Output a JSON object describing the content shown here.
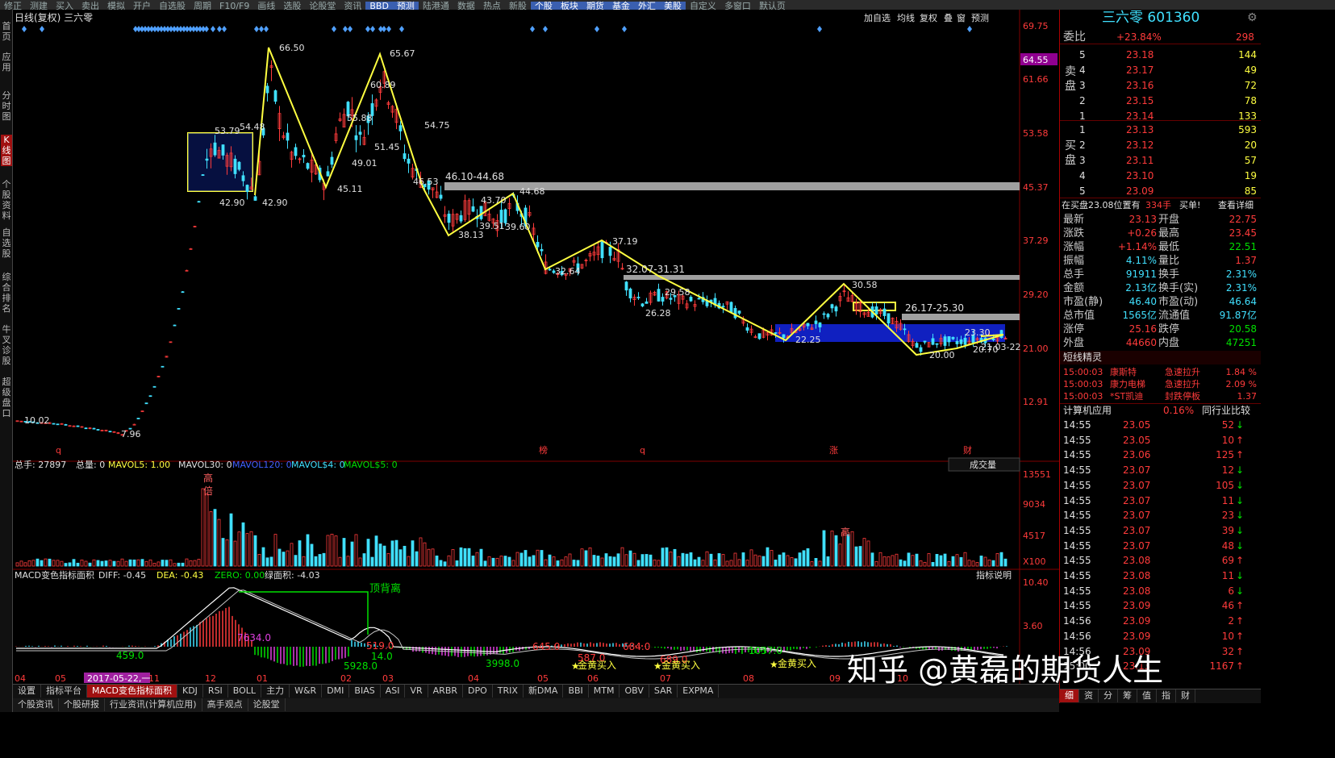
{
  "toolbar": {
    "items": [
      "修正",
      "测建",
      "买入",
      "卖出",
      "模拟",
      "开户",
      "自选股",
      "周期",
      "F10/F9",
      "画线",
      "选股",
      "论股堂",
      "资讯",
      "BBD",
      "预测",
      "陆港通",
      "数据",
      "热点",
      "新股",
      "个股",
      "板块",
      "期货",
      "基金",
      "外汇",
      "美股",
      "自定义",
      "多窗口",
      "默认页"
    ]
  },
  "leftnav": {
    "items": [
      "首页",
      "应用",
      "分时图",
      "K线图",
      "个股资料",
      "自选股",
      "综合排名",
      "牛叉诊股",
      "超级盘口"
    ]
  },
  "kchart": {
    "title": "日线(复权)  三六零",
    "right_menu": [
      "加自选",
      "均线",
      "复权",
      "叠",
      "窗",
      "预测"
    ],
    "price_axis": [
      "69.75",
      "61.66",
      "53.58",
      "45.37",
      "37.29",
      "29.20",
      "21.00",
      "12.91"
    ],
    "current_price_tag": "64.55",
    "bottom_markers": [
      "q",
      "榜",
      "q",
      "涨",
      "财"
    ],
    "annotations": {
      "p66_50": "66.50",
      "p65_67": "65.67",
      "p53_79": "53.79",
      "p54_48": "54.48",
      "p60_89": "60.89",
      "p54_75": "54.75",
      "p55_88": "55.88",
      "p51_45": "51.45",
      "p49_01": "49.01",
      "p45_11": "45.11",
      "p46_53": "46.53",
      "p42_90a": "42.90",
      "p42_90b": "42.90",
      "p43_70": "43.70",
      "p44_68": "44.68",
      "p39_51": "39.51",
      "p39_60": "39.60",
      "p38_13": "38.13",
      "p37_19": "37.19",
      "p32_64": "32.64",
      "p29_58": "29.58",
      "p26_28": "26.28",
      "p22_25": "22.25",
      "p30_58": "30.58",
      "p23_30": "23.30",
      "p20_00": "20.00",
      "p20_70": "20.70",
      "p21_03": "21.03",
      "p10_02": "10.02",
      "p7_96": "7.96",
      "zone1": "46.10-44.68",
      "zone2": "32.07-31.31",
      "zone3": "26.17-25.30",
      "zone4": "21.03-22"
    }
  },
  "volume": {
    "label": "总手: 27897",
    "total": "总量: 0",
    "mavol5": "MAVOL5: 1.00",
    "mavol30": "MAVOL30: 0",
    "mavol120": "MAVOL120: 0",
    "mavols4": "MAVOL$4: 0",
    "mavols5": "MAVOL$5: 0",
    "selector": "成交量",
    "axis": [
      "13551",
      "9034",
      "4517",
      "X100"
    ],
    "markers": [
      "高",
      "倍",
      "高"
    ]
  },
  "macd": {
    "title": "MACD变色指标面积",
    "diff": "DIFF: -0.45",
    "dea": "DEA: -0.43",
    "zero": "ZERO: 0.00",
    "green_area": "绿面积: -4.03",
    "help": "指标说明",
    "axis": [
      "10.40",
      "3.60"
    ],
    "labels": {
      "div": "顶背离",
      "v459": "459.0",
      "v7634": "7634.0",
      "v519": "519.0",
      "v14": "14.0",
      "v5928": "5928.0",
      "v3998": "3998.0",
      "v645": "645.0",
      "v684": "684.0",
      "v1037": "1037.0",
      "v587": "587.0",
      "v689": "689.0",
      "buy1": "金黄买入",
      "buy2": "金黄买入",
      "buy3": "金黄买入"
    },
    "months": [
      "04",
      "05",
      "2017-05-22,一",
      "11",
      "12",
      "01",
      "02",
      "03",
      "04",
      "05",
      "06",
      "07",
      "08",
      "09",
      "10"
    ]
  },
  "tabs": [
    "设置",
    "指标平台",
    "MACD变色指标面积",
    "KDJ",
    "RSI",
    "BOLL",
    "主力",
    "W&R",
    "DMI",
    "BIAS",
    "ASI",
    "VR",
    "ARBR",
    "DPO",
    "TRIX",
    "新DMA",
    "BBI",
    "MTM",
    "OBV",
    "SAR",
    "EXPMA"
  ],
  "tabs2": [
    "个股资讯",
    "个股研报",
    "行业资讯(计算机应用)",
    "高手观点",
    "论股堂"
  ],
  "quote": {
    "name": "三六零 601360",
    "weibi_label": "委比",
    "weibi": "+23.84%",
    "weicha": "298",
    "sell_label": "卖盘",
    "buy_label": "买盘",
    "asks": [
      {
        "lvl": "5",
        "price": "23.18",
        "vol": "144"
      },
      {
        "lvl": "4",
        "price": "23.17",
        "vol": "49"
      },
      {
        "lvl": "3",
        "price": "23.16",
        "vol": "72"
      },
      {
        "lvl": "2",
        "price": "23.15",
        "vol": "78"
      },
      {
        "lvl": "1",
        "price": "23.14",
        "vol": "133"
      }
    ],
    "bids": [
      {
        "lvl": "1",
        "price": "23.13",
        "vol": "593"
      },
      {
        "lvl": "2",
        "price": "23.12",
        "vol": "20"
      },
      {
        "lvl": "3",
        "price": "23.11",
        "vol": "57"
      },
      {
        "lvl": "4",
        "price": "23.10",
        "vol": "19"
      },
      {
        "lvl": "5",
        "price": "23.09",
        "vol": "85"
      }
    ],
    "position_note": "在买盘23.08位置有",
    "position_vol": "334手",
    "position_tag": "买单!",
    "detail_link": "查看详细",
    "stats": [
      {
        "l1": "最新",
        "v1": "23.13",
        "l2": "开盘",
        "v2": "22.75"
      },
      {
        "l1": "涨跌",
        "v1": "+0.26",
        "l2": "最高",
        "v2": "23.45"
      },
      {
        "l1": "涨幅",
        "v1": "+1.14%",
        "l2": "最低",
        "v2": "22.51"
      },
      {
        "l1": "振幅",
        "v1": "4.11%",
        "l2": "量比",
        "v2": "1.37"
      },
      {
        "l1": "总手",
        "v1": "91911",
        "l2": "换手",
        "v2": "2.31%"
      },
      {
        "l1": "金额",
        "v1": "2.13亿",
        "l2": "换手(实)",
        "v2": "2.31%"
      },
      {
        "l1": "市盈(静)",
        "v1": "46.40",
        "l2": "市盈(动)",
        "v2": "46.64"
      },
      {
        "l1": "总市值",
        "v1": "1565亿",
        "l2": "流通值",
        "v2": "91.87亿"
      },
      {
        "l1": "涨停",
        "v1": "25.16",
        "l2": "跌停",
        "v2": "20.58"
      },
      {
        "l1": "外盘",
        "v1": "44660",
        "l2": "内盘",
        "v2": "47251"
      }
    ],
    "spirit_title": "短线精灵",
    "spirit": [
      {
        "time": "15:00:03",
        "name": "康斯特",
        "act": "急速拉升",
        "pct": "1.84 %"
      },
      {
        "time": "15:00:03",
        "name": "康力电梯",
        "act": "急速拉升",
        "pct": "2.09 %"
      },
      {
        "time": "15:00:03",
        "name": "*ST凯迪",
        "act": "封跌停板",
        "pct": "1.37"
      }
    ],
    "industry": "计算机应用",
    "industry_pct": "0.16%",
    "industry_cmp": "同行业比较",
    "ticks": [
      {
        "t": "14:55",
        "p": "23.05",
        "v": "52",
        "d": "down"
      },
      {
        "t": "14:55",
        "p": "23.05",
        "v": "10",
        "d": "up"
      },
      {
        "t": "14:55",
        "p": "23.06",
        "v": "125",
        "d": "up"
      },
      {
        "t": "14:55",
        "p": "23.07",
        "v": "12",
        "d": "down"
      },
      {
        "t": "14:55",
        "p": "23.07",
        "v": "105",
        "d": "down"
      },
      {
        "t": "14:55",
        "p": "23.07",
        "v": "11",
        "d": "down"
      },
      {
        "t": "14:55",
        "p": "23.07",
        "v": "23",
        "d": "down"
      },
      {
        "t": "14:55",
        "p": "23.07",
        "v": "39",
        "d": "down"
      },
      {
        "t": "14:55",
        "p": "23.07",
        "v": "48",
        "d": "down"
      },
      {
        "t": "14:55",
        "p": "23.08",
        "v": "69",
        "d": "up"
      },
      {
        "t": "14:55",
        "p": "23.08",
        "v": "11",
        "d": "down"
      },
      {
        "t": "14:55",
        "p": "23.08",
        "v": "6",
        "d": "down"
      },
      {
        "t": "14:55",
        "p": "23.09",
        "v": "46",
        "d": "up"
      },
      {
        "t": "14:56",
        "p": "23.09",
        "v": "2",
        "d": "up"
      },
      {
        "t": "14:56",
        "p": "23.09",
        "v": "10",
        "d": "up"
      },
      {
        "t": "14:56",
        "p": "23.09",
        "v": "32",
        "d": "up"
      },
      {
        "t": "15:00",
        "p": "23.13",
        "v": "1167",
        "d": "up"
      }
    ],
    "bottom_tabs": [
      "细",
      "资",
      "分",
      "筹",
      "值",
      "指",
      "财"
    ]
  },
  "watermark": "知乎 @黄磊的期货人生",
  "colors": {
    "up": "#ff3b3b",
    "down": "#40e0ff",
    "zigzag": "#ffff40",
    "box": "#1020c0",
    "zone": "#a0a0a0"
  }
}
